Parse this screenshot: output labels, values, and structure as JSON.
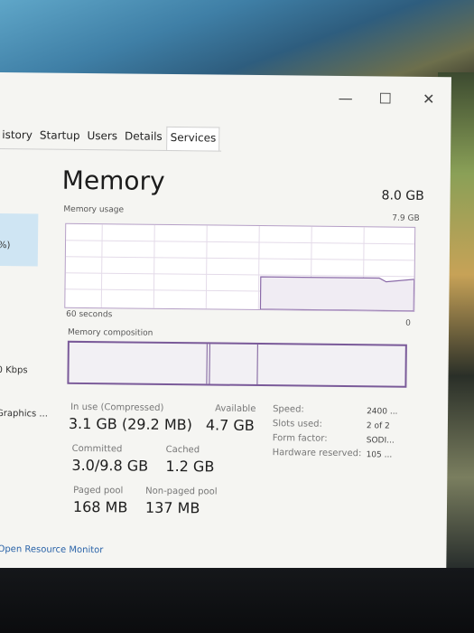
{
  "window": {
    "minimize": "—",
    "maximize": "☐",
    "close": "✕"
  },
  "tabs": [
    "istory",
    "Startup",
    "Users",
    "Details",
    "Services"
  ],
  "sidebar": {
    "item_percent": "%)",
    "item_network": "0 Kbps",
    "item_gpu": "Graphics ..."
  },
  "memory": {
    "title": "Memory",
    "total": "8.0 GB",
    "usage_label": "Memory usage",
    "usage_max": "7.9 GB",
    "time_label": "60 seconds",
    "zero_label": "0",
    "composition_label": "Memory composition",
    "usage_fraction": 0.39
  },
  "stats": {
    "in_use_label": "In use (Compressed)",
    "in_use_value": "3.1 GB (29.2 MB)",
    "available_label": "Available",
    "available_value": "4.7 GB",
    "committed_label": "Committed",
    "committed_value": "3.0/9.8 GB",
    "cached_label": "Cached",
    "cached_value": "1.2 GB",
    "paged_label": "Paged pool",
    "paged_value": "168 MB",
    "nonpaged_label": "Non-paged pool",
    "nonpaged_value": "137 MB"
  },
  "specs": {
    "speed_label": "Speed:",
    "speed_value": "2400 ...",
    "slots_label": "Slots used:",
    "slots_value": "2 of 2",
    "form_label": "Form factor:",
    "form_value": "SODI...",
    "reserved_label": "Hardware reserved:",
    "reserved_value": "105 ..."
  },
  "footer": {
    "link": "Open Resource Monitor"
  }
}
